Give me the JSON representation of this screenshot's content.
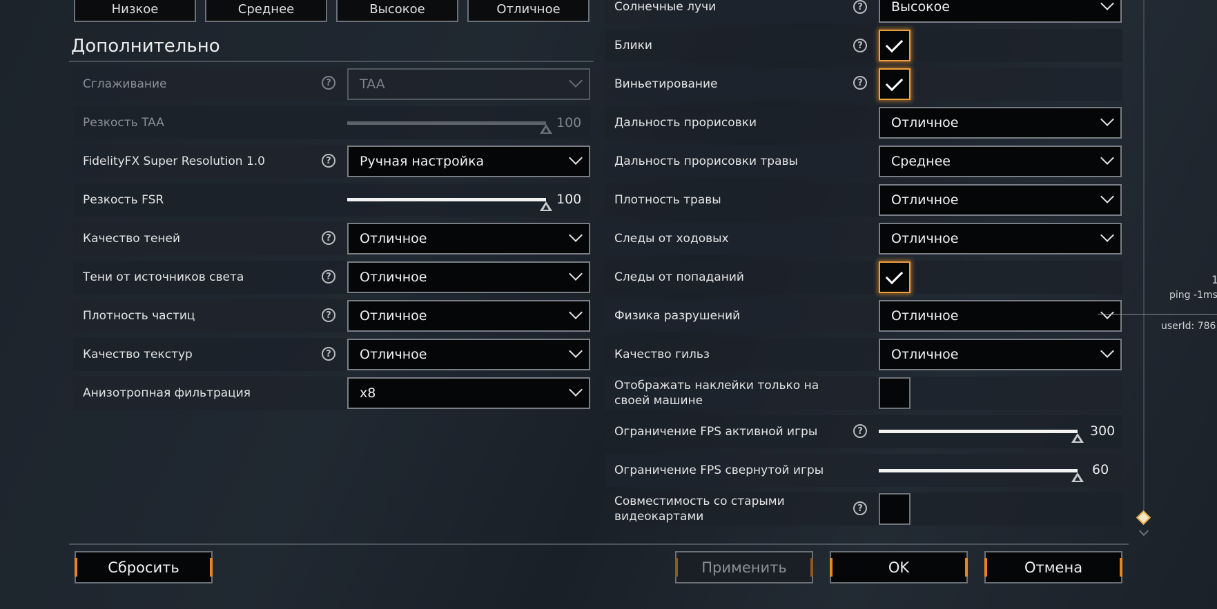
{
  "presets": [
    "Низкое",
    "Среднее",
    "Высокое",
    "Отличное"
  ],
  "section_title": "Дополнительно",
  "left_rows": [
    {
      "label": "Сглаживание",
      "type": "select",
      "value": "TAA",
      "help": "?",
      "disabled": true
    },
    {
      "label": "Резкость TAA",
      "type": "slider",
      "value": "100",
      "level": 1.0,
      "disabled": true
    },
    {
      "label": "FidelityFX Super Resolution 1.0",
      "type": "select",
      "value": "Ручная настройка",
      "help": "?"
    },
    {
      "label": "Резкость FSR",
      "type": "slider",
      "value": "100",
      "level": 1.0
    },
    {
      "label": "Качество теней",
      "type": "select",
      "value": "Отличное",
      "help": "?"
    },
    {
      "label": "Тени от источников света",
      "type": "select",
      "value": "Отличное",
      "help": "?"
    },
    {
      "label": "Плотность частиц",
      "type": "select",
      "value": "Отличное",
      "help": "?"
    },
    {
      "label": "Качество текстур",
      "type": "select",
      "value": "Отличное",
      "help": "?"
    },
    {
      "label": "Анизотропная фильтрация",
      "type": "select",
      "value": "x8"
    }
  ],
  "right_rows": [
    {
      "label": "Солнечные лучи",
      "type": "select",
      "value": "Высокое",
      "help": "?"
    },
    {
      "label": "Блики",
      "type": "checkbox",
      "checked": true,
      "help": "?"
    },
    {
      "label": "Виньетирование",
      "type": "checkbox",
      "checked": true,
      "help": "?"
    },
    {
      "label": "Дальность прорисовки",
      "type": "select",
      "value": "Отличное"
    },
    {
      "label": "Дальность прорисовки травы",
      "type": "select",
      "value": "Среднее"
    },
    {
      "label": "Плотность травы",
      "type": "select",
      "value": "Отличное"
    },
    {
      "label": "Следы от ходовых",
      "type": "select",
      "value": "Отличное"
    },
    {
      "label": "Следы от попаданий",
      "type": "checkbox",
      "checked": true
    },
    {
      "label": "Физика разрушений",
      "type": "select",
      "value": "Отличное"
    },
    {
      "label": "Качество гильз",
      "type": "select",
      "value": "Отличное"
    },
    {
      "label": "Отображать наклейки только на своей машине",
      "type": "checkbox",
      "checked": false
    },
    {
      "label": "Ограничение FPS активной игры",
      "type": "slider",
      "value": "300",
      "level": 1.0,
      "help": "?"
    },
    {
      "label": "Ограничение FPS свернутой игры",
      "type": "slider",
      "value": "60",
      "level": 1.0
    },
    {
      "label": "Совместимость со старыми видеокартами",
      "type": "checkbox",
      "checked": false,
      "help": "?"
    }
  ],
  "buttons": {
    "reset": "Сбросить",
    "apply": "Применить",
    "ok": "OK",
    "cancel": "Отмена"
  },
  "overlay": {
    "line1": "1",
    "ping": "ping -1ms",
    "user": "userId: 786"
  },
  "colors": {
    "accent": "#e8861f",
    "checkbox_glow": "#f0a23a",
    "background": "#1f262e"
  }
}
